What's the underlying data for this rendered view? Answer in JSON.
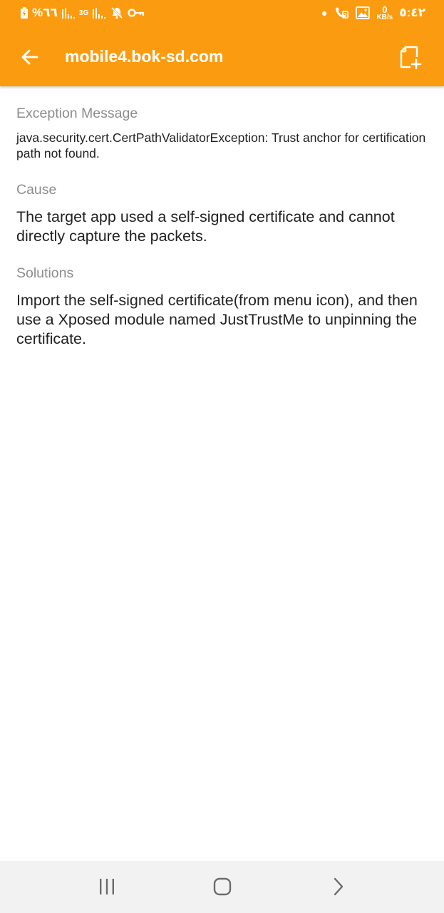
{
  "status_bar": {
    "battery_percent": "%٦٦",
    "network_type": "3G",
    "time": "٥:٤٢",
    "data_rate_value": "0",
    "data_rate_unit": "KB/s",
    "icons_left": [
      "battery-charging-icon",
      "signal-icon",
      "signal-3g-icon",
      "mute-icon",
      "vpn-key-icon"
    ],
    "icons_right": [
      "dot-icon",
      "wifi-call-icon",
      "gallery-icon",
      "data-rate-indicator"
    ]
  },
  "toolbar": {
    "title": "mobile4.bok-sd.com",
    "back_icon": "arrow-back-icon",
    "action_icon": "add-document-icon"
  },
  "sections": {
    "exception": {
      "label": "Exception Message",
      "text": "java.security.cert.CertPathValidatorException: Trust anchor for certification path not found."
    },
    "cause": {
      "label": "Cause",
      "text": "The target app used a self-signed certificate and cannot directly capture the packets."
    },
    "solutions": {
      "label": "Solutions",
      "text": "Import the self-signed certificate(from menu icon), and then use a Xposed module named JustTrustMe to unpinning the certificate."
    }
  },
  "nav_bar": {
    "icons": [
      "recents-icon",
      "home-icon",
      "back-chevron-icon"
    ]
  },
  "colors": {
    "accent": "#fb9c10",
    "label_gray": "#8d8d8d",
    "text_dark": "#222222",
    "nav_background": "#f2f2f2"
  }
}
